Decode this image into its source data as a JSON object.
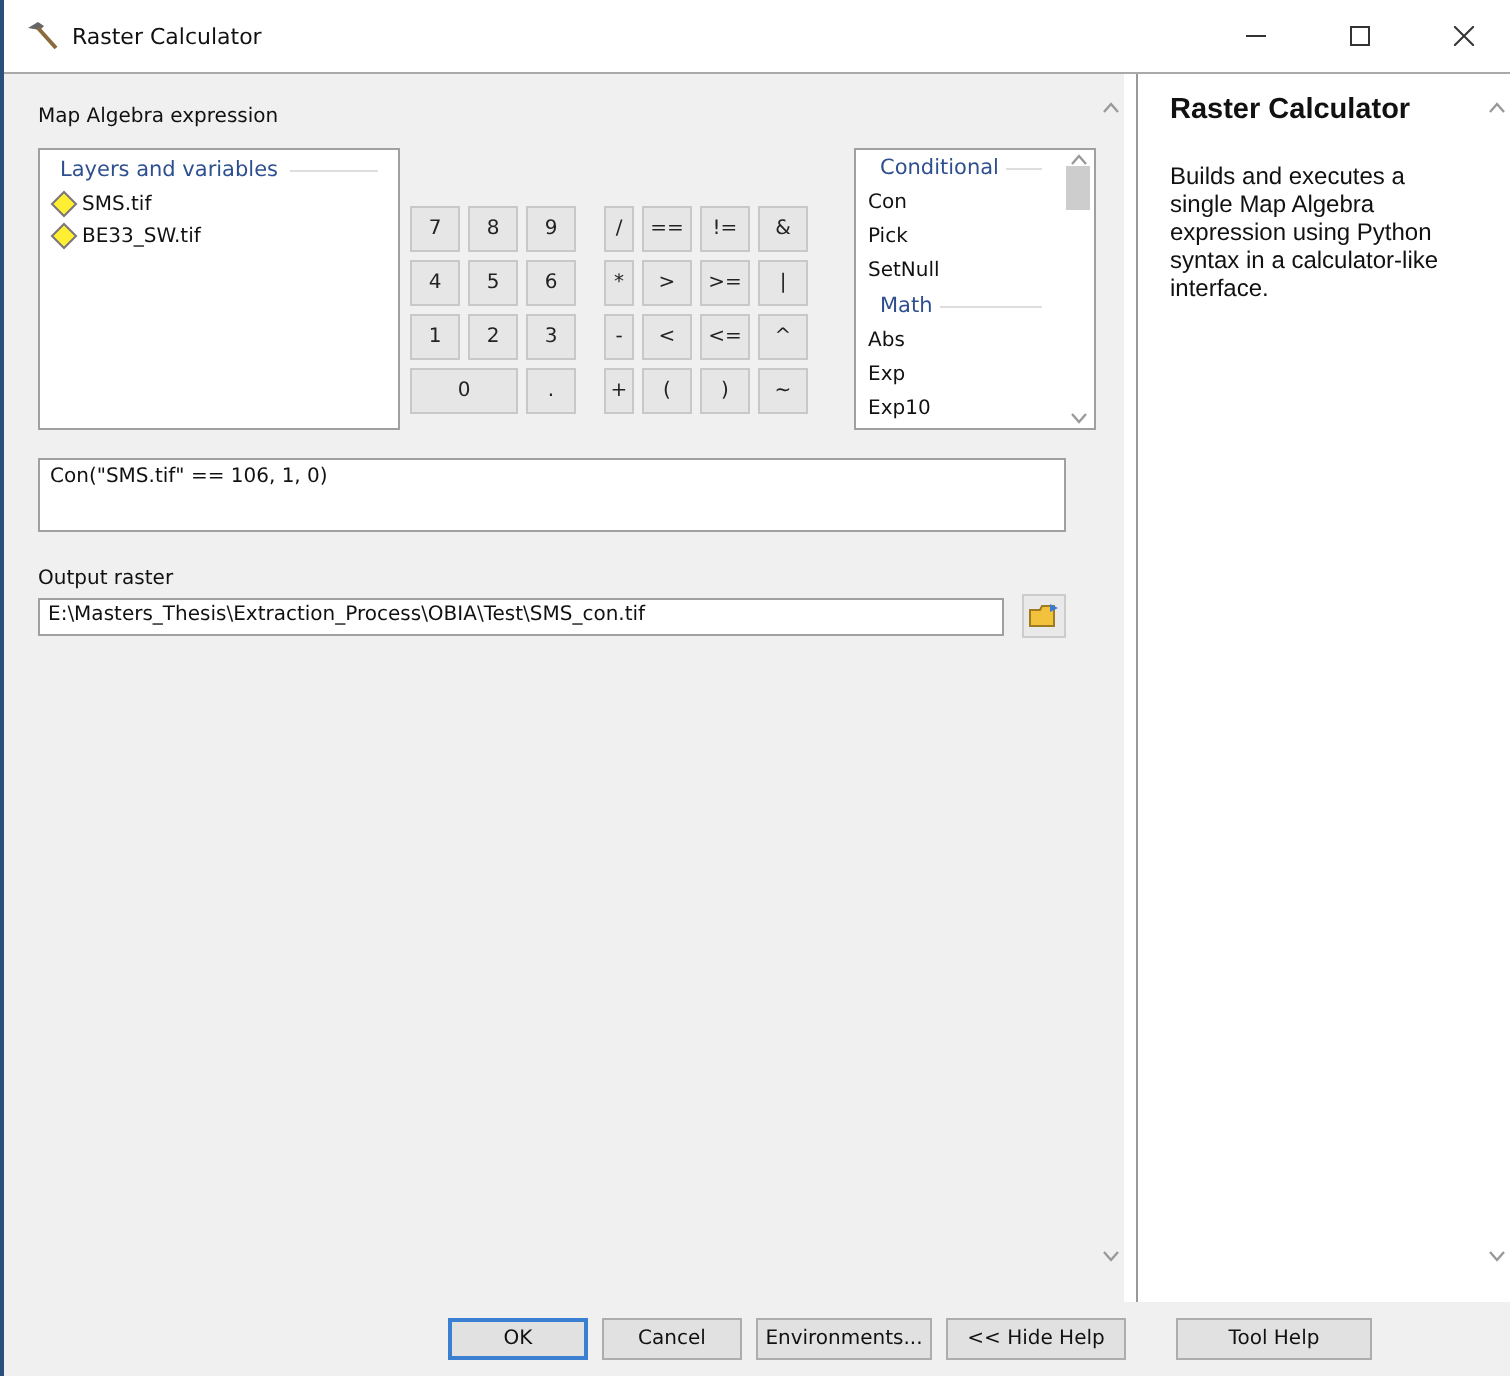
{
  "window": {
    "title": "Raster Calculator"
  },
  "expression_section": {
    "label": "Map Algebra expression"
  },
  "layers": {
    "heading": "Layers and variables",
    "items": [
      {
        "name": "SMS.tif"
      },
      {
        "name": "BE33_SW.tif"
      }
    ]
  },
  "keypad": [
    [
      {
        "label": "7",
        "kind": "digit"
      },
      {
        "label": "8",
        "kind": "digit"
      },
      {
        "label": "9",
        "kind": "digit"
      },
      {
        "label": "/",
        "kind": "op"
      },
      {
        "label": "==",
        "kind": "op"
      },
      {
        "label": "!=",
        "kind": "op"
      },
      {
        "label": "&",
        "kind": "op"
      }
    ],
    [
      {
        "label": "4",
        "kind": "digit"
      },
      {
        "label": "5",
        "kind": "digit"
      },
      {
        "label": "6",
        "kind": "digit"
      },
      {
        "label": "*",
        "kind": "op"
      },
      {
        "label": ">",
        "kind": "op"
      },
      {
        "label": ">=",
        "kind": "op"
      },
      {
        "label": "|",
        "kind": "op"
      }
    ],
    [
      {
        "label": "1",
        "kind": "digit"
      },
      {
        "label": "2",
        "kind": "digit"
      },
      {
        "label": "3",
        "kind": "digit"
      },
      {
        "label": "-",
        "kind": "op"
      },
      {
        "label": "<",
        "kind": "op"
      },
      {
        "label": "<=",
        "kind": "op"
      },
      {
        "label": "^",
        "kind": "op"
      }
    ],
    [
      {
        "label": "0",
        "kind": "wide"
      },
      {
        "label": ".",
        "kind": "digit"
      },
      {
        "label": "+",
        "kind": "op"
      },
      {
        "label": "(",
        "kind": "op"
      },
      {
        "label": ")",
        "kind": "op"
      },
      {
        "label": "~",
        "kind": "op"
      }
    ]
  ],
  "functions": [
    {
      "kind": "heading",
      "label": "Conditional"
    },
    {
      "kind": "item",
      "label": "Con"
    },
    {
      "kind": "item",
      "label": "Pick"
    },
    {
      "kind": "item",
      "label": "SetNull"
    },
    {
      "kind": "heading",
      "label": "Math"
    },
    {
      "kind": "item",
      "label": "Abs"
    },
    {
      "kind": "item",
      "label": "Exp"
    },
    {
      "kind": "item",
      "label": "Exp10"
    }
  ],
  "expression": {
    "value": "Con(\"SMS.tif\" == 106, 1, 0)"
  },
  "output_raster": {
    "label": "Output raster",
    "value": "E:\\Masters_Thesis\\Extraction_Process\\OBIA\\Test\\SMS_con.tif"
  },
  "help": {
    "title": "Raster Calculator",
    "text": "Builds and executes a single Map Algebra expression using Python syntax in a calculator-like interface."
  },
  "buttons": [
    {
      "label": "OK",
      "focused": true
    },
    {
      "label": "Cancel",
      "focused": false
    },
    {
      "label": "Environments...",
      "focused": false
    },
    {
      "label": "<< Hide Help",
      "focused": false
    },
    {
      "label": "Tool Help",
      "focused": false
    }
  ]
}
